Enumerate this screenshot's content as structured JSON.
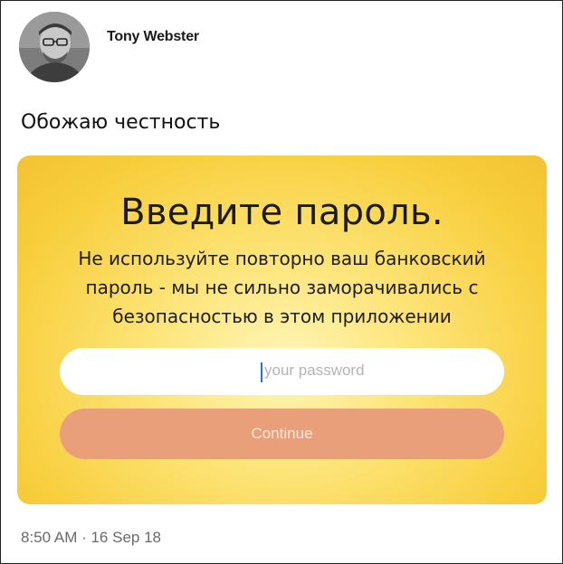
{
  "author": {
    "name": "Tony Webster",
    "avatar_icon": "person-photo-icon"
  },
  "tweet": {
    "text": "Обожаю честность",
    "timestamp": "8:50 AM · 16 Sep 18"
  },
  "card": {
    "title": "Введите пароль.",
    "subtitle": "Не используйте повторно ваш банковский пароль - мы не сильно заморачивались с безопасностью в этом приложении",
    "password_placeholder": "your password",
    "continue_label": "Continue",
    "colors": {
      "background": "#fde57a",
      "button": "#e9a07a",
      "button_text": "#fbe6d6"
    }
  }
}
